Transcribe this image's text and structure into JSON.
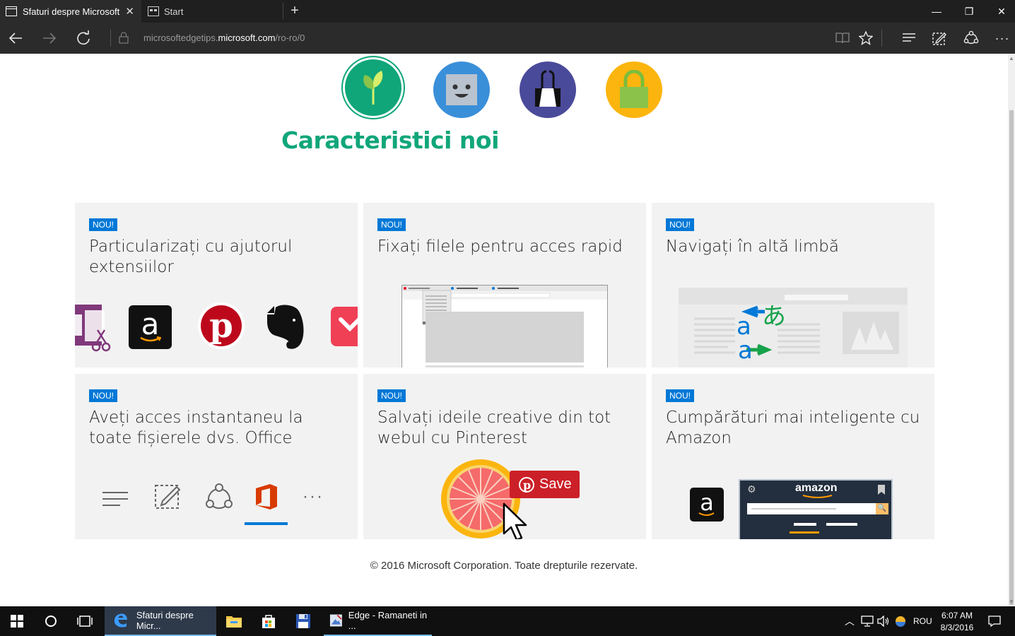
{
  "browser": {
    "tabs": [
      {
        "label": "Sfaturi despre Microsoft Edge"
      },
      {
        "label": "Start"
      }
    ],
    "address": {
      "prefix": "microsoftedgetips.",
      "domain": "microsoft.com",
      "path": "/ro-ro/0"
    }
  },
  "page": {
    "heading": "Caracteristici noi",
    "cards": [
      {
        "badge": "NOU!",
        "title": "Particularizați cu ajutorul extensiilor"
      },
      {
        "badge": "NOU!",
        "title": "Fixați filele pentru acces rapid"
      },
      {
        "badge": "NOU!",
        "title": "Navigați în altă limbă"
      },
      {
        "badge": "NOU!",
        "title": "Aveți acces instantaneu la toate fișierele dvs. Office"
      },
      {
        "badge": "NOU!",
        "title": "Salvați ideile creative din tot webul cu Pinterest"
      },
      {
        "badge": "NOU!",
        "title": "Cumpărături mai inteligente cu Amazon"
      }
    ],
    "pinterest_save": "Save",
    "amazon_logo": "amazon",
    "footer": "© 2016 Microsoft Corporation. Toate drepturile rezervate."
  },
  "taskbar": {
    "apps": [
      {
        "label": "Sfaturi despre Micr..."
      },
      {
        "label": "Edge - Ramaneti in ..."
      }
    ],
    "language": "ROU",
    "time": "6:07 AM",
    "date": "8/3/2016"
  },
  "colors": {
    "accent": "#0078d7",
    "heading": "#10a67a",
    "card": "#f2f2f2"
  }
}
